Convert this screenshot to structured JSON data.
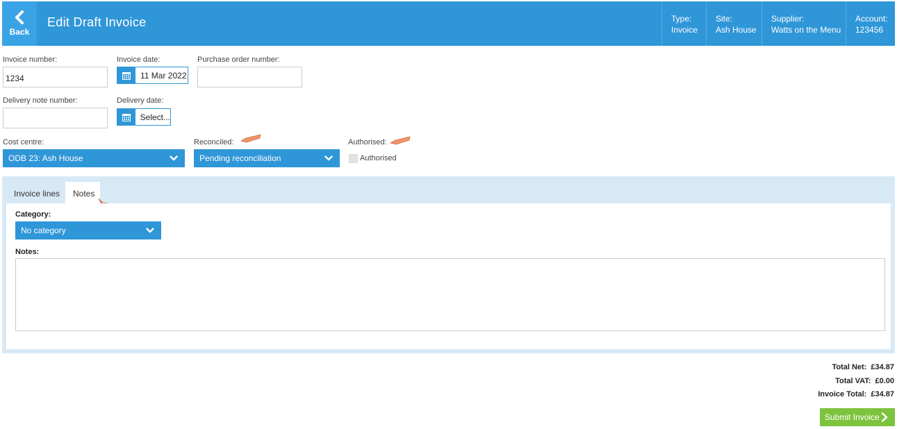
{
  "header": {
    "back_label": "Back",
    "title": "Edit Draft Invoice",
    "info": [
      {
        "label": "Type:",
        "value": "Invoice"
      },
      {
        "label": "Site:",
        "value": "Ash House"
      },
      {
        "label": "Supplier:",
        "value": "Watts on the Menu"
      },
      {
        "label": "Account:",
        "value": "123456"
      }
    ]
  },
  "form": {
    "invoice_number": {
      "label": "Invoice number:",
      "value": "1234"
    },
    "invoice_date": {
      "label": "Invoice date:",
      "value": "11 Mar 2022"
    },
    "po_number": {
      "label": "Purchase order number:",
      "value": ""
    },
    "delivery_note": {
      "label": "Delivery note number:",
      "value": ""
    },
    "delivery_date": {
      "label": "Delivery date:",
      "value": "Select..."
    },
    "cost_centre": {
      "label": "Cost centre:",
      "value": "ODB 23: Ash House"
    },
    "reconciled": {
      "label": "Reconciled:",
      "value": "Pending reconciliation"
    },
    "authorised": {
      "label": "Authorised:",
      "checkbox_label": "Authorised"
    }
  },
  "tabs": [
    {
      "label": "Invoice lines"
    },
    {
      "label": "Notes"
    }
  ],
  "notes_tab": {
    "category_label": "Category:",
    "category_value": "No category",
    "notes_label": "Notes:",
    "notes_value": ""
  },
  "totals": {
    "net_label": "Total Net:",
    "net_value": "£34.87",
    "vat_label": "Total VAT:",
    "vat_value": "£0.00",
    "total_label": "Invoice Total:",
    "total_value": "£34.87"
  },
  "submit_label": "Submit Invoice",
  "colors": {
    "primary": "#2f96d8",
    "panel_bg": "#d8e9f6",
    "submit": "#7ec33e",
    "annotation": "#f0956a"
  }
}
